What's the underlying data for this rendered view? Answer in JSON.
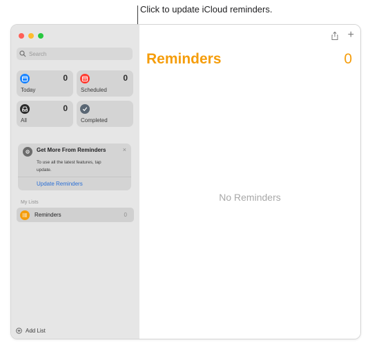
{
  "callout": {
    "text": "Click to update iCloud reminders."
  },
  "sidebar": {
    "search": {
      "placeholder": "Search"
    },
    "smart_lists": [
      {
        "label": "Today",
        "count": "0",
        "icon": "calendar-icon",
        "color": "#1a84ff"
      },
      {
        "label": "Scheduled",
        "count": "0",
        "icon": "calendar-icon",
        "color": "#ff3b30"
      },
      {
        "label": "All",
        "count": "0",
        "icon": "tray-icon",
        "color": "#2b2b2b"
      },
      {
        "label": "Completed",
        "count": "",
        "icon": "checkmark-icon",
        "color": "#5a6774"
      }
    ],
    "promo": {
      "title": "Get More From Reminders",
      "body": "To use all the latest features, tap update.",
      "link": "Update Reminders",
      "close": "×"
    },
    "my_lists_header": "My Lists",
    "lists": [
      {
        "name": "Reminders",
        "count": "0",
        "color": "#f59d0b"
      }
    ],
    "add_list_label": "Add List"
  },
  "main": {
    "title": "Reminders",
    "count": "0",
    "empty_text": "No Reminders",
    "accent_color": "#f59d0b"
  }
}
